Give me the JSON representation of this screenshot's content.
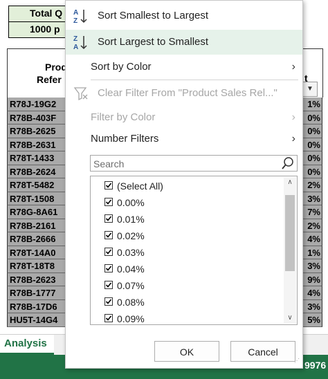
{
  "sheet": {
    "total_label": "Total Q",
    "total_value": "1000 p",
    "header_line1": "Prod",
    "header_line2": "Refer",
    "header_right_symbol": "t",
    "rows": [
      {
        "ref": "R78J-19G2",
        "pct": "1%"
      },
      {
        "ref": "R78B-403F",
        "pct": "0%"
      },
      {
        "ref": "R78B-2625",
        "pct": "0%"
      },
      {
        "ref": "R78B-2631",
        "pct": "0%"
      },
      {
        "ref": "R78T-1433",
        "pct": "0%"
      },
      {
        "ref": "R78B-2624",
        "pct": "0%"
      },
      {
        "ref": "R78T-5482",
        "pct": "2%"
      },
      {
        "ref": "R78T-1508",
        "pct": "3%"
      },
      {
        "ref": "R78G-8A61",
        "pct": "7%"
      },
      {
        "ref": "R78B-2161",
        "pct": "2%"
      },
      {
        "ref": "R78B-2666",
        "pct": "4%"
      },
      {
        "ref": "R78T-14A0",
        "pct": "1%"
      },
      {
        "ref": "R78T-18T8",
        "pct": "3%"
      },
      {
        "ref": "R78B-2623",
        "pct": "9%"
      },
      {
        "ref": "R78B-1777",
        "pct": "4%"
      },
      {
        "ref": "R78B-17D6",
        "pct": "3%"
      },
      {
        "ref": "HU5T-14G4",
        "pct": "5%"
      }
    ],
    "sheet_tab": "Analysis",
    "status_value": "9976",
    "accent_color": "#217346"
  },
  "menu": {
    "sort_asc": "Sort Smallest to Largest",
    "sort_desc": "Sort Largest to Smallest",
    "sort_by_color": "Sort by Color",
    "clear_filter": "Clear Filter From \"Product Sales Rel...\"",
    "filter_by_color": "Filter by Color",
    "number_filters": "Number Filters",
    "search_placeholder": "Search",
    "list_items": [
      "(Select All)",
      "0.00%",
      "0.01%",
      "0.02%",
      "0.03%",
      "0.04%",
      "0.07%",
      "0.08%",
      "0.09%"
    ],
    "ok_label": "OK",
    "cancel_label": "Cancel"
  }
}
